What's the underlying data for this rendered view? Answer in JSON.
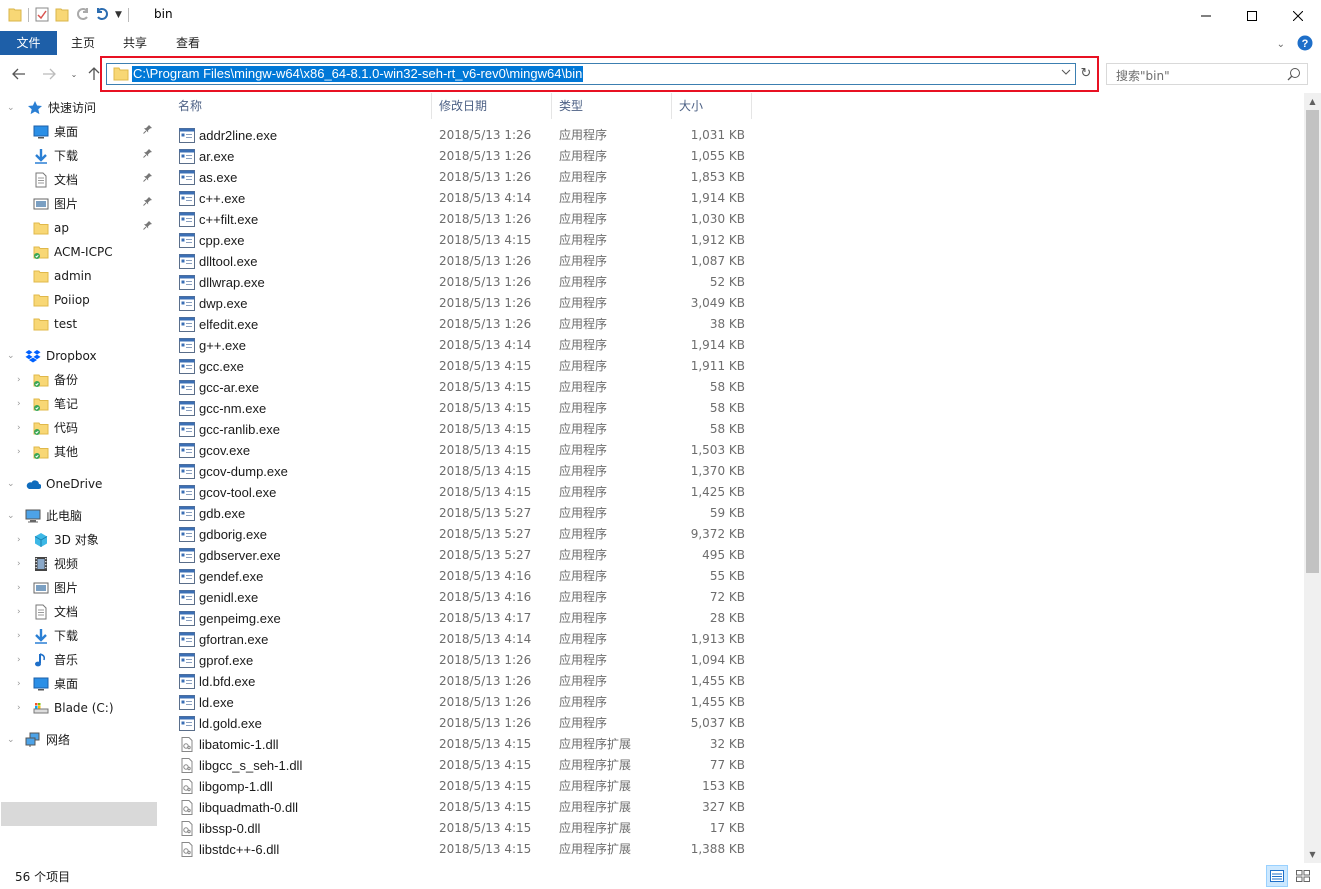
{
  "window": {
    "title": "bin"
  },
  "ribbon": {
    "tabs": [
      "文件",
      "主页",
      "共享",
      "查看"
    ]
  },
  "address": {
    "path": "C:\\Program Files\\mingw-w64\\x86_64-8.1.0-win32-seh-rt_v6-rev0\\mingw64\\bin"
  },
  "search": {
    "placeholder": "搜索\"bin\""
  },
  "sidebar": {
    "items": [
      {
        "label": "快速访问",
        "icon": "star-icon"
      },
      {
        "label": "桌面",
        "icon": "desktop-icon",
        "pinned": true
      },
      {
        "label": "下载",
        "icon": "download-icon",
        "pinned": true
      },
      {
        "label": "文档",
        "icon": "document-icon",
        "pinned": true
      },
      {
        "label": "图片",
        "icon": "picture-icon",
        "pinned": true
      },
      {
        "label": "ap",
        "icon": "folder-icon",
        "pinned": true
      },
      {
        "label": "ACM-ICPC",
        "icon": "folder-icon"
      },
      {
        "label": "admin",
        "icon": "folder-icon"
      },
      {
        "label": "Poiiop",
        "icon": "folder-icon"
      },
      {
        "label": "test",
        "icon": "folder-icon"
      },
      {
        "label": "Dropbox",
        "icon": "dropbox-icon"
      },
      {
        "label": "备份",
        "icon": "folder-icon"
      },
      {
        "label": "笔记",
        "icon": "folder-icon"
      },
      {
        "label": "代码",
        "icon": "folder-icon"
      },
      {
        "label": "其他",
        "icon": "folder-icon"
      },
      {
        "label": "OneDrive",
        "icon": "onedrive-icon"
      },
      {
        "label": "此电脑",
        "icon": "computer-icon"
      },
      {
        "label": "3D 对象",
        "icon": "3d-objects-icon"
      },
      {
        "label": "视频",
        "icon": "video-icon"
      },
      {
        "label": "图片",
        "icon": "picture-icon"
      },
      {
        "label": "文档",
        "icon": "document-icon"
      },
      {
        "label": "下载",
        "icon": "download-icon"
      },
      {
        "label": "音乐",
        "icon": "music-icon"
      },
      {
        "label": "桌面",
        "icon": "desktop-icon"
      },
      {
        "label": "Blade (C:)",
        "icon": "drive-icon"
      },
      {
        "label": "网络",
        "icon": "network-icon"
      }
    ]
  },
  "columns": {
    "name": "名称",
    "date": "修改日期",
    "type": "类型",
    "size": "大小"
  },
  "files": [
    {
      "name": "addr2line.exe",
      "date": "2018/5/13 1:26",
      "type": "应用程序",
      "size": "1,031 KB",
      "kind": "exe"
    },
    {
      "name": "ar.exe",
      "date": "2018/5/13 1:26",
      "type": "应用程序",
      "size": "1,055 KB",
      "kind": "exe"
    },
    {
      "name": "as.exe",
      "date": "2018/5/13 1:26",
      "type": "应用程序",
      "size": "1,853 KB",
      "kind": "exe"
    },
    {
      "name": "c++.exe",
      "date": "2018/5/13 4:14",
      "type": "应用程序",
      "size": "1,914 KB",
      "kind": "exe"
    },
    {
      "name": "c++filt.exe",
      "date": "2018/5/13 1:26",
      "type": "应用程序",
      "size": "1,030 KB",
      "kind": "exe"
    },
    {
      "name": "cpp.exe",
      "date": "2018/5/13 4:15",
      "type": "应用程序",
      "size": "1,912 KB",
      "kind": "exe"
    },
    {
      "name": "dlltool.exe",
      "date": "2018/5/13 1:26",
      "type": "应用程序",
      "size": "1,087 KB",
      "kind": "exe"
    },
    {
      "name": "dllwrap.exe",
      "date": "2018/5/13 1:26",
      "type": "应用程序",
      "size": "52 KB",
      "kind": "exe"
    },
    {
      "name": "dwp.exe",
      "date": "2018/5/13 1:26",
      "type": "应用程序",
      "size": "3,049 KB",
      "kind": "exe"
    },
    {
      "name": "elfedit.exe",
      "date": "2018/5/13 1:26",
      "type": "应用程序",
      "size": "38 KB",
      "kind": "exe"
    },
    {
      "name": "g++.exe",
      "date": "2018/5/13 4:14",
      "type": "应用程序",
      "size": "1,914 KB",
      "kind": "exe"
    },
    {
      "name": "gcc.exe",
      "date": "2018/5/13 4:15",
      "type": "应用程序",
      "size": "1,911 KB",
      "kind": "exe"
    },
    {
      "name": "gcc-ar.exe",
      "date": "2018/5/13 4:15",
      "type": "应用程序",
      "size": "58 KB",
      "kind": "exe"
    },
    {
      "name": "gcc-nm.exe",
      "date": "2018/5/13 4:15",
      "type": "应用程序",
      "size": "58 KB",
      "kind": "exe"
    },
    {
      "name": "gcc-ranlib.exe",
      "date": "2018/5/13 4:15",
      "type": "应用程序",
      "size": "58 KB",
      "kind": "exe"
    },
    {
      "name": "gcov.exe",
      "date": "2018/5/13 4:15",
      "type": "应用程序",
      "size": "1,503 KB",
      "kind": "exe"
    },
    {
      "name": "gcov-dump.exe",
      "date": "2018/5/13 4:15",
      "type": "应用程序",
      "size": "1,370 KB",
      "kind": "exe"
    },
    {
      "name": "gcov-tool.exe",
      "date": "2018/5/13 4:15",
      "type": "应用程序",
      "size": "1,425 KB",
      "kind": "exe"
    },
    {
      "name": "gdb.exe",
      "date": "2018/5/13 5:27",
      "type": "应用程序",
      "size": "59 KB",
      "kind": "exe"
    },
    {
      "name": "gdborig.exe",
      "date": "2018/5/13 5:27",
      "type": "应用程序",
      "size": "9,372 KB",
      "kind": "exe"
    },
    {
      "name": "gdbserver.exe",
      "date": "2018/5/13 5:27",
      "type": "应用程序",
      "size": "495 KB",
      "kind": "exe"
    },
    {
      "name": "gendef.exe",
      "date": "2018/5/13 4:16",
      "type": "应用程序",
      "size": "55 KB",
      "kind": "exe"
    },
    {
      "name": "genidl.exe",
      "date": "2018/5/13 4:16",
      "type": "应用程序",
      "size": "72 KB",
      "kind": "exe"
    },
    {
      "name": "genpeimg.exe",
      "date": "2018/5/13 4:17",
      "type": "应用程序",
      "size": "28 KB",
      "kind": "exe"
    },
    {
      "name": "gfortran.exe",
      "date": "2018/5/13 4:14",
      "type": "应用程序",
      "size": "1,913 KB",
      "kind": "exe"
    },
    {
      "name": "gprof.exe",
      "date": "2018/5/13 1:26",
      "type": "应用程序",
      "size": "1,094 KB",
      "kind": "exe"
    },
    {
      "name": "ld.bfd.exe",
      "date": "2018/5/13 1:26",
      "type": "应用程序",
      "size": "1,455 KB",
      "kind": "exe"
    },
    {
      "name": "ld.exe",
      "date": "2018/5/13 1:26",
      "type": "应用程序",
      "size": "1,455 KB",
      "kind": "exe"
    },
    {
      "name": "ld.gold.exe",
      "date": "2018/5/13 1:26",
      "type": "应用程序",
      "size": "5,037 KB",
      "kind": "exe"
    },
    {
      "name": "libatomic-1.dll",
      "date": "2018/5/13 4:15",
      "type": "应用程序扩展",
      "size": "32 KB",
      "kind": "dll"
    },
    {
      "name": "libgcc_s_seh-1.dll",
      "date": "2018/5/13 4:15",
      "type": "应用程序扩展",
      "size": "77 KB",
      "kind": "dll"
    },
    {
      "name": "libgomp-1.dll",
      "date": "2018/5/13 4:15",
      "type": "应用程序扩展",
      "size": "153 KB",
      "kind": "dll"
    },
    {
      "name": "libquadmath-0.dll",
      "date": "2018/5/13 4:15",
      "type": "应用程序扩展",
      "size": "327 KB",
      "kind": "dll"
    },
    {
      "name": "libssp-0.dll",
      "date": "2018/5/13 4:15",
      "type": "应用程序扩展",
      "size": "17 KB",
      "kind": "dll"
    },
    {
      "name": "libstdc++-6.dll",
      "date": "2018/5/13 4:15",
      "type": "应用程序扩展",
      "size": "1,388 KB",
      "kind": "dll"
    }
  ],
  "status": {
    "count": "56 个项目"
  },
  "colors": {
    "accent": "#1e5fa8",
    "selection": "#0078d7",
    "highlight_border": "#e81123",
    "folder": "#f8d775"
  }
}
